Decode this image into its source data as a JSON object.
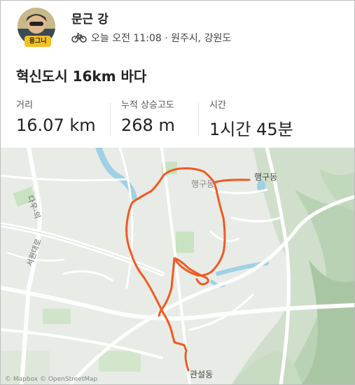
{
  "athlete": {
    "name": "문근 강",
    "avatar_badge": "용그니"
  },
  "activity": {
    "sport_icon": "bike-icon",
    "time_location": "오늘 오전 11:08 · 원주시, 강원도",
    "title": "혁신도시 16km 바다"
  },
  "stats": [
    {
      "label": "거리",
      "value": "16.07 km"
    },
    {
      "label": "누적 상승고도",
      "value": "268 m"
    },
    {
      "label": "시간",
      "value": "1시간 45분"
    }
  ],
  "map": {
    "labels": {
      "road_west": "다우-의",
      "road_south": "서원대로",
      "district_north": "행구동",
      "place_north": "행구동",
      "district_south": "관설동"
    },
    "attribution": "© Mapbox © OpenStreetMap",
    "route_color": "#f05a20"
  }
}
